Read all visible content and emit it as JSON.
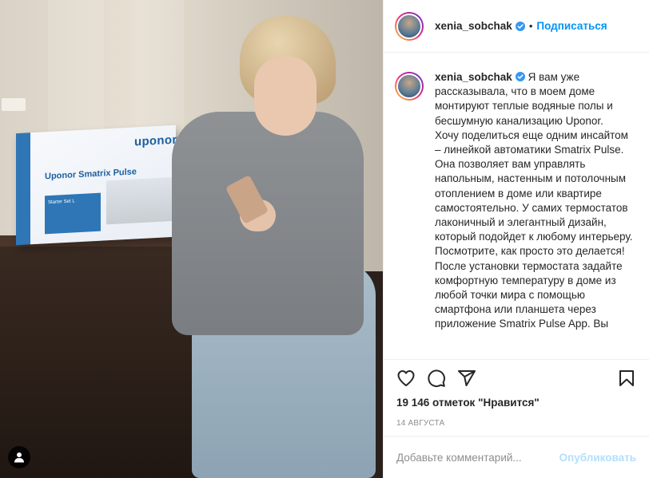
{
  "photo": {
    "box_brand": "uponor",
    "box_product": "Uponor Smatrix Pulse",
    "box_card": "Starter Set L",
    "user_tag_icon": "user-icon"
  },
  "header": {
    "username": "xenia_sobchak",
    "dot": "•",
    "follow_label": "Подписаться",
    "verified_icon": "verified-badge-icon"
  },
  "caption": {
    "username": "xenia_sobchak",
    "text": "Я вам уже рассказывала, что в моем доме монтируют теплые водяные полы и бесшумную канализацию Uponor.\nХочу поделиться еще одним инсайтом – линейкой автоматики Smatrix Pulse. Она позволяет вам управлять напольным, настенным и потолочным отоплением в доме или квартире самостоятельно. У самих термостатов лаконичный и элегантный дизайн, который подойдет к любому интерьеру. Посмотрите, как просто это делается!\nПосле установки термостата задайте комфортную температуру в доме из любой точки мира с помощью смартфона или планшета через приложение Smatrix Pulse App. Вы"
  },
  "actions": {
    "like_icon": "heart-icon",
    "comment_icon": "comment-icon",
    "share_icon": "share-icon",
    "save_icon": "bookmark-icon"
  },
  "likes": "19 146 отметок \"Нравится\"",
  "date": "14 августа",
  "add_comment": {
    "placeholder": "Добавьте комментарий...",
    "post_label": "Опубликовать"
  },
  "colors": {
    "accent": "#0095f6",
    "post_disabled": "#b2dffc",
    "text": "#262626",
    "muted": "#8e8e8e"
  }
}
